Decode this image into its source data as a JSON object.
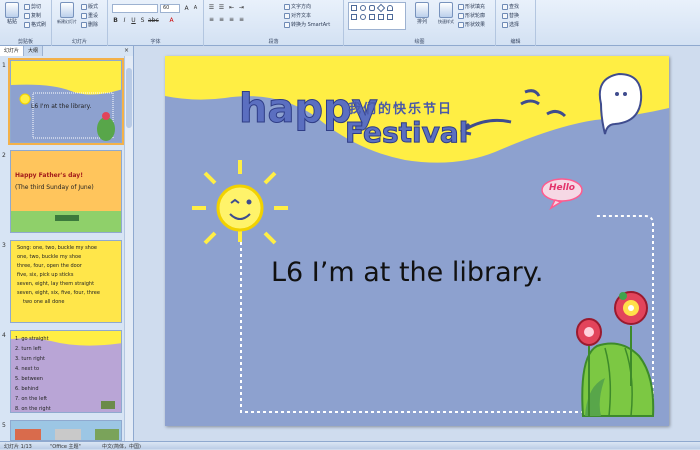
{
  "ribbon": {
    "clipboard": {
      "paste": "粘贴",
      "cut": "剪切",
      "copy": "复制",
      "format_painter": "格式刷",
      "label": "剪贴板"
    },
    "slides": {
      "new_slide": "新建幻灯片",
      "layout": "版式",
      "reset": "重设",
      "delete": "删除",
      "label": "幻灯片"
    },
    "font": {
      "font_size": "60",
      "label": "字体"
    },
    "paragraph": {
      "text_direction": "文字方向",
      "align_text": "对齐文本",
      "smartart": "转换为 SmartArt",
      "label": "段落"
    },
    "drawing": {
      "arrange": "排列",
      "quick_styles": "快速样式",
      "shape_fill": "形状填充",
      "shape_outline": "形状轮廓",
      "shape_effects": "形状效果",
      "label": "绘图"
    },
    "editing": {
      "find": "查找",
      "replace": "替换",
      "select": "选择",
      "label": "编辑"
    }
  },
  "panel": {
    "tabs": [
      "幻灯片",
      "大纲"
    ],
    "close": "×",
    "slides": [
      {
        "num": "1",
        "lines": [
          "L6    I'm at the library."
        ]
      },
      {
        "num": "2",
        "lines": [
          "Happy Father's day!",
          "(The third Sunday of June)"
        ]
      },
      {
        "num": "3",
        "lines": [
          "Song: one, two, buckle my shoe",
          "one, two, buckle my shoe",
          "three, four, open the door",
          "five, six, pick up sticks",
          "seven, eight, lay them straight",
          "seven, eight, six, five, four, three",
          "two one all done"
        ]
      },
      {
        "num": "4",
        "lines": [
          "1.  go straight",
          "2.  turn left",
          "3.  turn right",
          "4.  next to",
          "5.  between",
          "6.  behind",
          "7.  on the left",
          "8.  on the right"
        ]
      },
      {
        "num": "5",
        "lines": []
      }
    ]
  },
  "slide": {
    "happy": "happy",
    "festival": "Festival",
    "chinese_title": "我们的快乐节日",
    "hello": "Hello",
    "title": "L6    I’m at the library."
  },
  "statusbar": {
    "slide_count": "幻灯片 1/13",
    "theme": "\"Office 主题\"",
    "language": "中文(简体，中国)"
  },
  "colors": {
    "slide_bg": "#8da1cf",
    "yellow": "#ffee44",
    "ribbon_bg": "#d3e1f3"
  }
}
